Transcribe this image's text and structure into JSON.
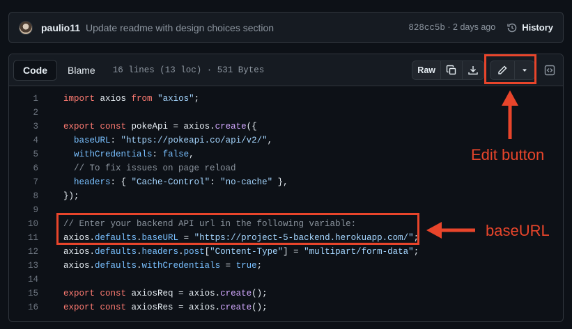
{
  "commit": {
    "author": "paulio11",
    "message": "Update readme with design choices section",
    "sha": "828cc5b",
    "separator": " · ",
    "age": "2 days ago",
    "history_label": "History"
  },
  "file_header": {
    "tabs": [
      {
        "label": "Code",
        "active": true
      },
      {
        "label": "Blame",
        "active": false
      }
    ],
    "info": "16 lines (13 loc) · 531 Bytes",
    "raw_label": "Raw"
  },
  "code": {
    "lines": [
      {
        "n": "1",
        "tokens": [
          [
            "kw",
            "import"
          ],
          [
            "pl",
            " axios "
          ],
          [
            "kw",
            "from"
          ],
          [
            "pl",
            " "
          ],
          [
            "str",
            "\"axios\""
          ],
          [
            "pl",
            ";"
          ]
        ]
      },
      {
        "n": "2",
        "tokens": []
      },
      {
        "n": "3",
        "tokens": [
          [
            "kw",
            "export"
          ],
          [
            "pl",
            " "
          ],
          [
            "kw",
            "const"
          ],
          [
            "pl",
            " pokeApi = axios."
          ],
          [
            "fn",
            "create"
          ],
          [
            "pl",
            "({"
          ]
        ]
      },
      {
        "n": "4",
        "tokens": [
          [
            "pl",
            "  "
          ],
          [
            "prop",
            "baseURL"
          ],
          [
            "pl",
            ": "
          ],
          [
            "str",
            "\"https://pokeapi.co/api/v2/\""
          ],
          [
            "pl",
            ","
          ]
        ]
      },
      {
        "n": "5",
        "tokens": [
          [
            "pl",
            "  "
          ],
          [
            "prop",
            "withCredentials"
          ],
          [
            "pl",
            ": "
          ],
          [
            "prop",
            "false"
          ],
          [
            "pl",
            ","
          ]
        ]
      },
      {
        "n": "6",
        "tokens": [
          [
            "pl",
            "  "
          ],
          [
            "com",
            "// To fix issues on page reload"
          ]
        ]
      },
      {
        "n": "7",
        "tokens": [
          [
            "pl",
            "  "
          ],
          [
            "prop",
            "headers"
          ],
          [
            "pl",
            ": { "
          ],
          [
            "str",
            "\"Cache-Control\""
          ],
          [
            "pl",
            ": "
          ],
          [
            "str",
            "\"no-cache\""
          ],
          [
            "pl",
            " },"
          ]
        ]
      },
      {
        "n": "8",
        "tokens": [
          [
            "pl",
            "});"
          ]
        ]
      },
      {
        "n": "9",
        "tokens": []
      },
      {
        "n": "10",
        "tokens": [
          [
            "com",
            "// Enter your backend API url in the following variable:"
          ]
        ]
      },
      {
        "n": "11",
        "tokens": [
          [
            "pl",
            "axios."
          ],
          [
            "prop",
            "defaults"
          ],
          [
            "pl",
            "."
          ],
          [
            "prop",
            "baseURL"
          ],
          [
            "pl",
            " = "
          ],
          [
            "str",
            "\"https://project-5-backend.herokuapp.com/\""
          ],
          [
            "pl",
            ";"
          ]
        ]
      },
      {
        "n": "12",
        "tokens": [
          [
            "pl",
            "axios."
          ],
          [
            "prop",
            "defaults"
          ],
          [
            "pl",
            "."
          ],
          [
            "prop",
            "headers"
          ],
          [
            "pl",
            "."
          ],
          [
            "prop",
            "post"
          ],
          [
            "pl",
            "["
          ],
          [
            "str",
            "\"Content-Type\""
          ],
          [
            "pl",
            "] = "
          ],
          [
            "str",
            "\"multipart/form-data\""
          ],
          [
            "pl",
            ";"
          ]
        ]
      },
      {
        "n": "13",
        "tokens": [
          [
            "pl",
            "axios."
          ],
          [
            "prop",
            "defaults"
          ],
          [
            "pl",
            "."
          ],
          [
            "prop",
            "withCredentials"
          ],
          [
            "pl",
            " = "
          ],
          [
            "prop",
            "true"
          ],
          [
            "pl",
            ";"
          ]
        ]
      },
      {
        "n": "14",
        "tokens": []
      },
      {
        "n": "15",
        "tokens": [
          [
            "kw",
            "export"
          ],
          [
            "pl",
            " "
          ],
          [
            "kw",
            "const"
          ],
          [
            "pl",
            " axiosReq = axios."
          ],
          [
            "fn",
            "create"
          ],
          [
            "pl",
            "();"
          ]
        ]
      },
      {
        "n": "16",
        "tokens": [
          [
            "kw",
            "export"
          ],
          [
            "pl",
            " "
          ],
          [
            "kw",
            "const"
          ],
          [
            "pl",
            " axiosRes = axios."
          ],
          [
            "fn",
            "create"
          ],
          [
            "pl",
            "();"
          ]
        ]
      }
    ]
  },
  "annotations": {
    "edit_label": "Edit button",
    "baseurl_label": "baseURL",
    "color": "#e8452b"
  },
  "icons": [
    "avatar",
    "history-icon",
    "copy-icon",
    "download-icon",
    "pencil-icon",
    "caret-down-icon",
    "symbols-icon",
    "arrow-icon"
  ]
}
